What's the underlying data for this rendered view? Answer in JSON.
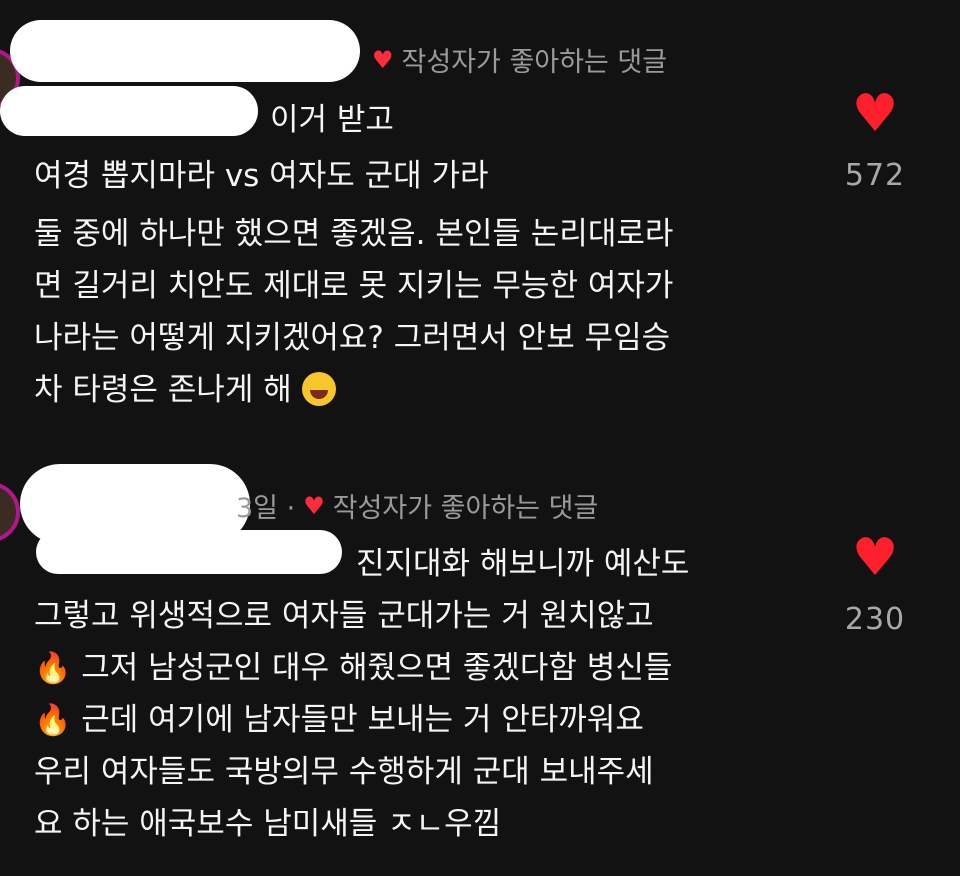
{
  "comments": [
    {
      "meta": "작성자가 좋아하는 댓글",
      "line1": "이거 받고",
      "line2": "여경 뽑지마라 vs 여자도 군대 가라",
      "body": [
        "둘 중에 하나만 했으면 좋겠음. 본인들 논리대로라",
        "면 길거리 치안도 제대로 못 지키는 무능한 여자가",
        "나라는 어떻게 지키겠어요? 그러면서 안보 무임승",
        "차 타령은 존나게 해"
      ],
      "likes": "572"
    },
    {
      "meta_time": "3일 ·",
      "meta": "작성자가 좋아하는 댓글",
      "body": [
        "진지대화 해보니까 예산도",
        "그렇고 위생적으로 여자들 군대가는 거 원치않고",
        "그저 남성군인 대우 해줬으면 좋겠다함 병신들",
        "근데 여기에 남자들만 보내는 거 안타까워요",
        "우리 여자들도 국방의무 수행하게 군대 보내주세",
        "요 하는 애국보수 남미새들 ㅈㄴ우낌"
      ],
      "likes": "230"
    }
  ],
  "icons": {
    "heart": "heart-icon",
    "laugh": "face-with-tears-of-joy-icon",
    "fire": "fire-icon"
  },
  "colors": {
    "background": "#121212",
    "heart": "#ff1f2c",
    "meta": "#9a9a9a",
    "avatar_ring": "#b0178a"
  }
}
